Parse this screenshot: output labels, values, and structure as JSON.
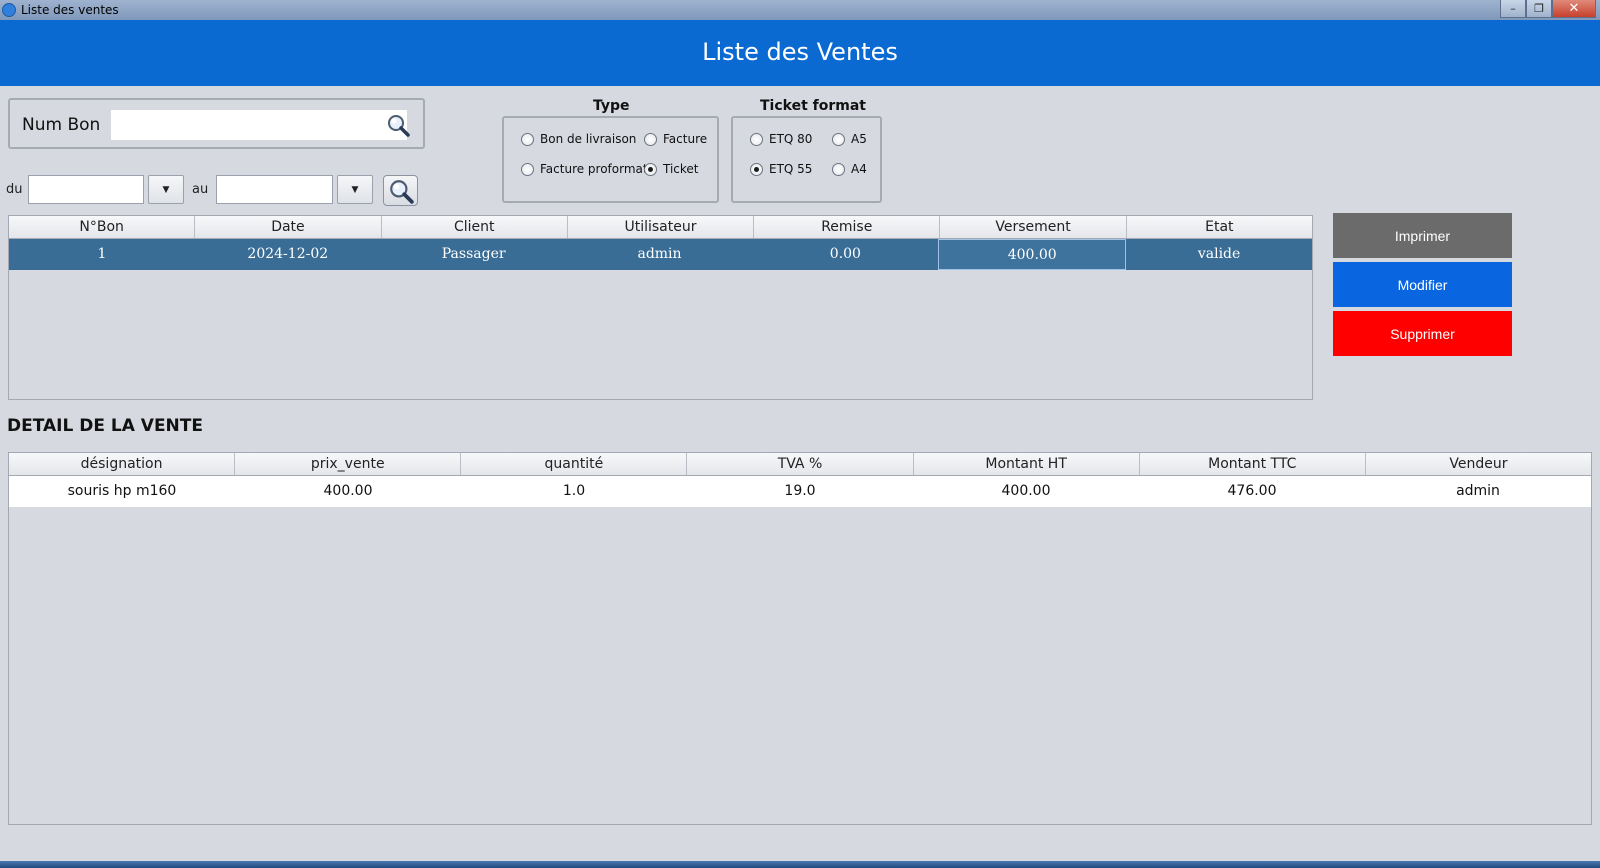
{
  "window": {
    "title": "Liste des ventes"
  },
  "header": {
    "title": "Liste des Ventes"
  },
  "search": {
    "num_bon_label": "Num Bon",
    "num_bon_value": ""
  },
  "dates": {
    "du_label": "du",
    "au_label": "au",
    "du_value": "",
    "au_value": ""
  },
  "type_group": {
    "title": "Type",
    "options": [
      {
        "label": "Bon de livraison",
        "selected": false
      },
      {
        "label": "Facture",
        "selected": false
      },
      {
        "label": "Facture proformat",
        "selected": false
      },
      {
        "label": "Ticket",
        "selected": true
      }
    ]
  },
  "ticket_group": {
    "title": "Ticket format",
    "options": [
      {
        "label": "ETQ 80",
        "selected": false
      },
      {
        "label": "A5",
        "selected": false
      },
      {
        "label": "ETQ 55",
        "selected": true
      },
      {
        "label": "A4",
        "selected": false
      }
    ]
  },
  "ventes_table": {
    "columns": [
      "N°Bon",
      "Date",
      "Client",
      "Utilisateur",
      "Remise",
      "Versement",
      "Etat"
    ],
    "rows": [
      [
        "1",
        "2024-12-02",
        "Passager",
        "admin",
        "0.00",
        "400.00",
        "valide"
      ]
    ]
  },
  "actions": {
    "print": "Imprimer",
    "edit": "Modifier",
    "delete": "Supprimer"
  },
  "detail": {
    "title": "DETAIL DE LA VENTE",
    "columns": [
      "désignation",
      "prix_vente",
      "quantité",
      "TVA %",
      "Montant HT",
      "Montant TTC",
      "Vendeur"
    ],
    "rows": [
      [
        "souris hp m160",
        "400.00",
        "1.0",
        "19.0",
        "400.00",
        "476.00",
        "admin"
      ]
    ]
  },
  "colors": {
    "banner": "#0a6ad2",
    "selected_row": "#3a6d96",
    "print_button": "#6b6b6b",
    "edit_button": "#0a66e0",
    "delete_button": "#ff0000"
  }
}
